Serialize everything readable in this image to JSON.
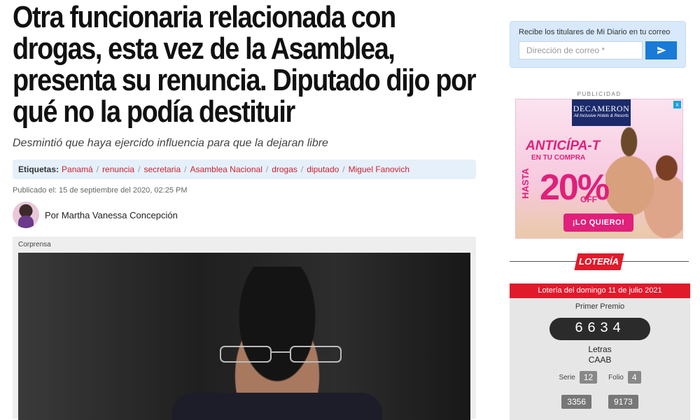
{
  "article": {
    "headline": "Otra funcionaria relacionada con drogas, esta vez de la Asamblea, presenta su renuncia. Diputado dijo por qué no la podía destituir",
    "subtitle": "Desmintió que haya ejercido influencia para que la dejaran libre",
    "tags_label": "Etiquetas:",
    "tags": [
      "Panamá",
      "renuncia",
      "secretaria",
      "Asamblea Nacional",
      "drogas",
      "diputado",
      "Miguel Fanovich"
    ],
    "published": "Publicado el: 15 de septiembre del 2020, 02:25 PM",
    "author": "Por Martha Vanessa Concepción",
    "photo_credit": "Corprensa"
  },
  "newsletter": {
    "title": "Recibe los titulares de Mi Diario en tu correo",
    "placeholder": "Dirección de correo *",
    "submit_icon": "send-icon"
  },
  "ad": {
    "label": "PUBLICIDAD",
    "brand": "DECAMERON",
    "brand_tagline": "All Inclusive Hotels & Resorts",
    "headline": "ANTICÍPA-T",
    "subhead": "EN TU COMPRA",
    "hasta": "HASTA",
    "discount": "20%",
    "off": "OFF",
    "cta": "¡LO QUIERO!",
    "close": "x"
  },
  "lottery": {
    "badge": "LOTERÍA",
    "header": "Lotería del domingo 11 de julio 2021",
    "first_prize_label": "Primer Premio",
    "first_prize_number": "6634",
    "letras_label": "Letras",
    "letras_value": "CAAB",
    "serie_label": "Serie",
    "serie_value": "12",
    "folio_label": "Folio",
    "folio_value": "4",
    "second_prize": "3356",
    "third_prize": "9173"
  },
  "colors": {
    "accent_red": "#e11a2b",
    "tag_red": "#d21f2b",
    "button_blue": "#1a7ad8",
    "ad_pink": "#e0207a"
  }
}
